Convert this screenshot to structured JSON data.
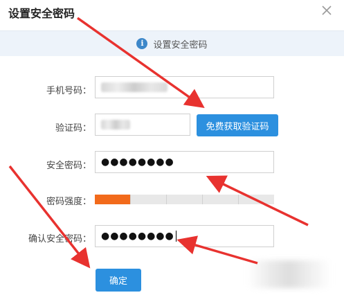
{
  "dialog": {
    "title": "设置安全密码",
    "info_text": "设置安全密码",
    "info_icon": "info-icon",
    "close_icon": "close-icon"
  },
  "form": {
    "phone_label": "手机号码：",
    "code_label": "验证码：",
    "password_label": "安全密码：",
    "password_value": "●●●●●●●●",
    "strength_label": "密码强度：",
    "strength_level": 0.2,
    "strength_segments": 5,
    "confirm_label": "确认安全密码：",
    "confirm_value": "●●●●●●●●"
  },
  "buttons": {
    "send_code": "免费获取验证码",
    "submit": "确定"
  },
  "colors": {
    "accent": "#2c90df",
    "strength_fill": "#f26a1b",
    "strength_empty": "#e8e8e8",
    "annotation_arrow": "#e8322f",
    "info_bar": "#edf3fa"
  }
}
